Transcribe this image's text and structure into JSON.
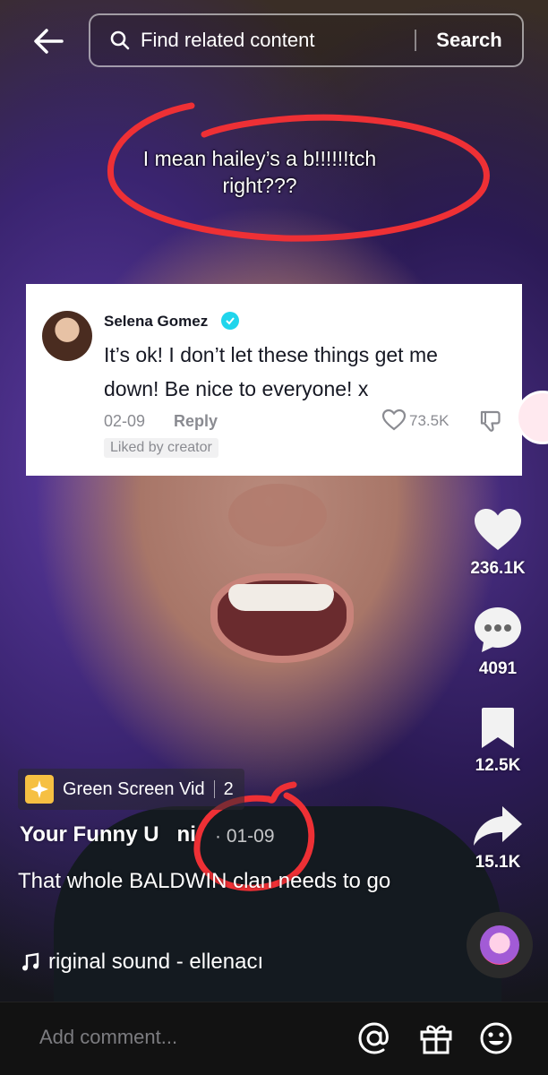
{
  "search": {
    "placeholder": "Find related content",
    "button": "Search"
  },
  "video": {
    "caption_line1": "I mean hailey’s a b!!!!!!tch",
    "caption_line2": "right???"
  },
  "comment_card": {
    "name": "Selena Gomez",
    "text": "It’s ok! I don’t let these things get me down! Be nice to everyone! x",
    "date": "02-09",
    "reply": "Reply",
    "likes": "73.5K",
    "liked_badge": "Liked by creator",
    "verified_color": "#20d5ec"
  },
  "actions": {
    "likes": "236.1K",
    "comments": "4091",
    "saves": "12.5K",
    "shares": "15.1K"
  },
  "post": {
    "effect_label": "Green Screen Vid",
    "effect_count": "2",
    "author": "Your Funny U",
    "author_suffix": "ni",
    "date": "· 01-09",
    "description": "That whole BALDWIN clan needs to go",
    "sound": "riginal sound - ellenacı"
  },
  "bottom_bar": {
    "comment_placeholder": "Add comment..."
  },
  "colors": {
    "annotation_red": "#ee3035",
    "effect_icon": "#f6c042",
    "bottom_bar": "#121212"
  },
  "icons": [
    "back-arrow-icon",
    "search-icon",
    "verified-icon",
    "heart-outline-icon",
    "dislike-icon",
    "heart-icon",
    "comment-icon",
    "bookmark-icon",
    "share-icon",
    "music-note-icon",
    "mention-icon",
    "gift-icon",
    "emoji-icon"
  ]
}
